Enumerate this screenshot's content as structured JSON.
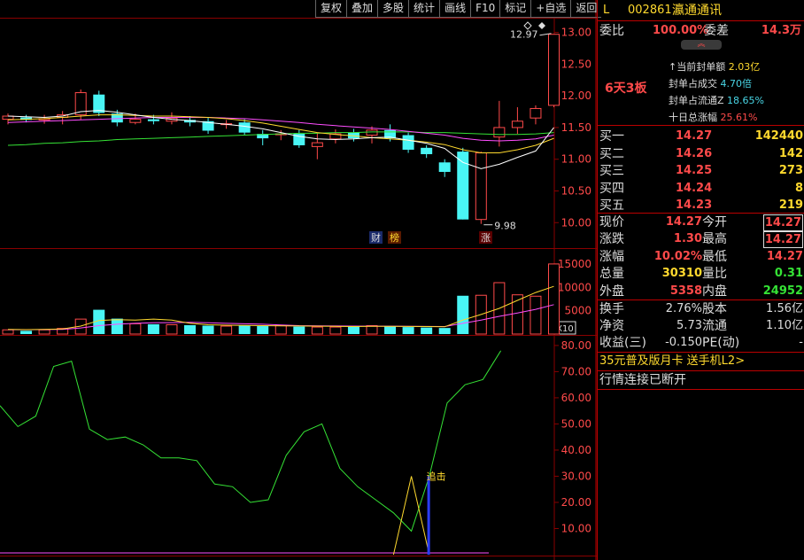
{
  "toolbar": [
    "复权",
    "叠加",
    "多股",
    "统计",
    "画线",
    "F10",
    "标记",
    "+自选",
    "返回"
  ],
  "colors": {
    "up": "#ff4a4a",
    "down": "#49f5f5",
    "ma5": "#ffffff",
    "ma10": "#ffd92e",
    "ma20": "#ff4dff",
    "ma60": "#35e235",
    "grid": "#8a0000"
  },
  "price_axis": [
    "13.00",
    "12.50",
    "12.00",
    "11.50",
    "11.00",
    "10.50",
    "10.00"
  ],
  "vol_axis": [
    "15000",
    "10000",
    "5000"
  ],
  "vol_unit": "X10",
  "ind_axis": [
    "80.00",
    "70.00",
    "60.00",
    "50.00",
    "40.00",
    "30.00",
    "20.00",
    "10.00"
  ],
  "markers": {
    "high_label": "12.97",
    "low_label": "9.98",
    "cai": "财",
    "bang": "榜",
    "zhang": "涨",
    "zhuiji": "追击"
  },
  "chart_data": {
    "type": "candlestick",
    "ylim": [
      9.85,
      13.05
    ],
    "candles": [
      {
        "o": 11.63,
        "c": 11.68,
        "h": 11.72,
        "l": 11.55
      },
      {
        "o": 11.66,
        "c": 11.62,
        "h": 11.7,
        "l": 11.58
      },
      {
        "o": 11.62,
        "c": 11.64,
        "h": 11.7,
        "l": 11.56
      },
      {
        "o": 11.66,
        "c": 11.7,
        "h": 11.76,
        "l": 11.55
      },
      {
        "o": 11.7,
        "c": 12.05,
        "h": 12.1,
        "l": 11.62
      },
      {
        "o": 12.02,
        "c": 11.73,
        "h": 12.08,
        "l": 11.68
      },
      {
        "o": 11.72,
        "c": 11.58,
        "h": 11.78,
        "l": 11.52
      },
      {
        "o": 11.58,
        "c": 11.63,
        "h": 11.72,
        "l": 11.55
      },
      {
        "o": 11.63,
        "c": 11.6,
        "h": 11.7,
        "l": 11.55
      },
      {
        "o": 11.6,
        "c": 11.65,
        "h": 11.74,
        "l": 11.55
      },
      {
        "o": 11.62,
        "c": 11.58,
        "h": 11.68,
        "l": 11.52
      },
      {
        "o": 11.6,
        "c": 11.45,
        "h": 11.66,
        "l": 11.4
      },
      {
        "o": 11.55,
        "c": 11.56,
        "h": 11.62,
        "l": 11.48
      },
      {
        "o": 11.58,
        "c": 11.42,
        "h": 11.63,
        "l": 11.38
      },
      {
        "o": 11.4,
        "c": 11.33,
        "h": 11.46,
        "l": 11.22
      },
      {
        "o": 11.4,
        "c": 11.4,
        "h": 11.46,
        "l": 11.3
      },
      {
        "o": 11.4,
        "c": 11.22,
        "h": 11.46,
        "l": 11.18
      },
      {
        "o": 11.2,
        "c": 11.26,
        "h": 11.42,
        "l": 11.0
      },
      {
        "o": 11.32,
        "c": 11.4,
        "h": 11.47,
        "l": 11.25
      },
      {
        "o": 11.42,
        "c": 11.33,
        "h": 11.48,
        "l": 11.28
      },
      {
        "o": 11.38,
        "c": 11.46,
        "h": 11.52,
        "l": 11.25
      },
      {
        "o": 11.46,
        "c": 11.33,
        "h": 11.55,
        "l": 11.28
      },
      {
        "o": 11.38,
        "c": 11.15,
        "h": 11.42,
        "l": 11.1
      },
      {
        "o": 11.18,
        "c": 11.08,
        "h": 11.22,
        "l": 11.02
      },
      {
        "o": 10.95,
        "c": 10.8,
        "h": 11.0,
        "l": 10.72
      },
      {
        "o": 11.12,
        "c": 10.05,
        "h": 11.18,
        "l": 10.05
      },
      {
        "o": 10.05,
        "c": 11.1,
        "h": 11.12,
        "l": 9.98
      },
      {
        "o": 11.35,
        "c": 11.5,
        "h": 11.92,
        "l": 11.2
      },
      {
        "o": 11.5,
        "c": 11.6,
        "h": 11.82,
        "l": 11.4
      },
      {
        "o": 11.65,
        "c": 11.8,
        "h": 11.85,
        "l": 11.55
      },
      {
        "o": 11.85,
        "c": 12.97,
        "h": 12.97,
        "l": 11.82
      }
    ],
    "ma5": [
      11.68,
      11.67,
      11.66,
      11.68,
      11.75,
      11.77,
      11.74,
      11.7,
      11.66,
      11.63,
      11.61,
      11.58,
      11.55,
      11.52,
      11.48,
      11.42,
      11.36,
      11.32,
      11.31,
      11.32,
      11.34,
      11.35,
      11.3,
      11.25,
      11.17,
      10.95,
      10.85,
      10.92,
      11.03,
      11.13,
      11.5
    ],
    "ma10": [
      11.62,
      11.63,
      11.64,
      11.66,
      11.68,
      11.7,
      11.7,
      11.69,
      11.68,
      11.68,
      11.67,
      11.66,
      11.64,
      11.61,
      11.57,
      11.52,
      11.47,
      11.42,
      11.39,
      11.37,
      11.34,
      11.32,
      11.3,
      11.27,
      11.23,
      11.15,
      11.1,
      11.1,
      11.15,
      11.22,
      11.33
    ],
    "ma20": [
      11.58,
      11.59,
      11.6,
      11.61,
      11.62,
      11.63,
      11.64,
      11.65,
      11.66,
      11.66,
      11.66,
      11.66,
      11.65,
      11.64,
      11.62,
      11.6,
      11.58,
      11.55,
      11.53,
      11.51,
      11.49,
      11.47,
      11.44,
      11.41,
      11.38,
      11.33,
      11.3,
      11.29,
      11.3,
      11.32,
      11.38
    ],
    "ma60": [
      11.22,
      11.23,
      11.25,
      11.26,
      11.28,
      11.29,
      11.31,
      11.32,
      11.33,
      11.34,
      11.35,
      11.36,
      11.37,
      11.38,
      11.39,
      11.4,
      11.41,
      11.41,
      11.42,
      11.42,
      11.43,
      11.43,
      11.43,
      11.42,
      11.42,
      11.41,
      11.4,
      11.39,
      11.39,
      11.4,
      11.42
    ],
    "volume": [
      900,
      700,
      900,
      1200,
      3200,
      5200,
      3300,
      2200,
      2100,
      2000,
      1900,
      1800,
      1700,
      1800,
      1700,
      1800,
      1600,
      1500,
      1500,
      1600,
      1800,
      1700,
      1500,
      1400,
      1300,
      8200,
      8300,
      11000,
      8400,
      8100,
      15000
    ],
    "vol_ylim": [
      0,
      16500
    ],
    "vol_ma5": [
      1000,
      950,
      1000,
      1100,
      1700,
      2900,
      3100,
      3000,
      3200,
      3000,
      2300,
      2000,
      1900,
      1850,
      1800,
      1750,
      1720,
      1680,
      1650,
      1620,
      1650,
      1660,
      1640,
      1620,
      1560,
      3000,
      4200,
      5500,
      7200,
      8900,
      10200
    ],
    "vol_ma10": [
      950,
      920,
      960,
      1000,
      1300,
      1800,
      2100,
      2300,
      2400,
      2450,
      2500,
      2400,
      2300,
      2200,
      2100,
      1950,
      1800,
      1760,
      1720,
      1700,
      1690,
      1680,
      1660,
      1640,
      1620,
      2300,
      3000,
      3800,
      4500,
      5300,
      6300
    ],
    "indicator_ylim": [
      0,
      82
    ],
    "indicator_line": [
      57,
      49,
      53,
      72,
      74,
      48,
      44,
      45,
      42,
      37,
      37,
      36,
      27,
      26,
      20,
      21,
      38,
      47,
      50,
      33,
      26,
      21,
      16,
      9,
      30,
      58,
      65,
      67,
      78
    ],
    "indicator_yellow": [
      0,
      0,
      0,
      0,
      0,
      0,
      0,
      0,
      0,
      0,
      0,
      0,
      0,
      0,
      0,
      0,
      0,
      0,
      0,
      0,
      0,
      0,
      0,
      30,
      0,
      0,
      0,
      0,
      0
    ],
    "indicator_blue_bar_index": 23
  },
  "panel": {
    "code_prefix": "L",
    "code": "002861",
    "name": "瀛通通讯",
    "weibi_label": "委比",
    "weibi_value": "100.00%",
    "weicha_label": "委差",
    "weicha_value": "14.3万",
    "board_label": "6天3板",
    "seal_lines": [
      {
        "label": "当前封单额",
        "value": "2.03亿"
      },
      {
        "label": "封单占成交",
        "value": "4.70倍"
      },
      {
        "label": "封单占流通Z",
        "value": "18.65%"
      },
      {
        "label": "十日总涨幅",
        "value": "25.61%"
      }
    ],
    "bids": [
      {
        "label": "买一",
        "price": "14.27",
        "vol": "142440"
      },
      {
        "label": "买二",
        "price": "14.26",
        "vol": "142"
      },
      {
        "label": "买三",
        "price": "14.25",
        "vol": "273"
      },
      {
        "label": "买四",
        "price": "14.24",
        "vol": "8"
      },
      {
        "label": "买五",
        "price": "14.23",
        "vol": "219"
      }
    ],
    "quote": [
      {
        "l1": "现价",
        "v1": "14.27",
        "l2": "今开",
        "v2": "14.27"
      },
      {
        "l1": "涨跌",
        "v1": "1.30",
        "l2": "最高",
        "v2": "14.27"
      },
      {
        "l1": "涨幅",
        "v1": "10.02%",
        "l2": "最低",
        "v2": "14.27"
      },
      {
        "l1": "总量",
        "v1": "30310",
        "l2": "量比",
        "v2": "0.31"
      },
      {
        "l1": "外盘",
        "v1": "5358",
        "l2": "内盘",
        "v2": "24952"
      }
    ],
    "fin": [
      {
        "l1": "换手",
        "v1": "2.76%",
        "l2": "股本",
        "v2": "1.56亿"
      },
      {
        "l1": "净资",
        "v1": "5.73",
        "l2": "流通",
        "v2": "1.10亿"
      },
      {
        "l1": "收益(三)",
        "v1": "-0.150",
        "l2": "PE(动)",
        "v2": "-"
      }
    ],
    "ad": "35元普及版月卡 送手机L2>",
    "status": "行情连接已断开"
  }
}
